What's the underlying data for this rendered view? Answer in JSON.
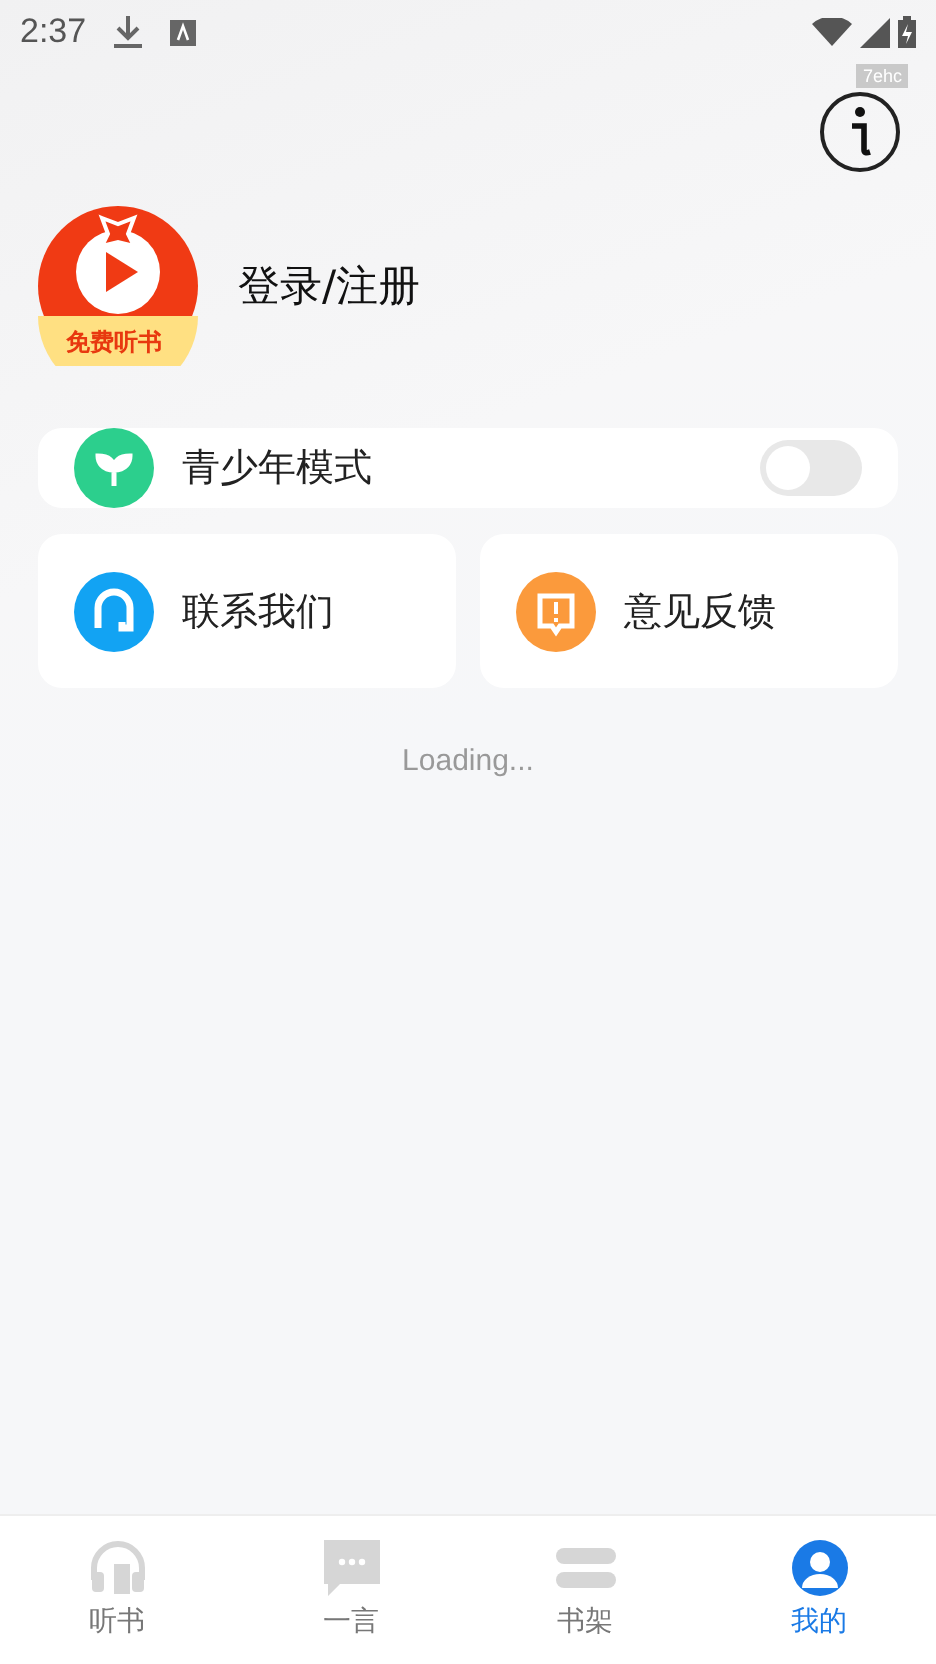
{
  "status_bar": {
    "time": "2:37"
  },
  "debug_tag": "7ehc",
  "profile": {
    "logo_caption": "免费听书",
    "login": "登录/注册"
  },
  "teen_mode": {
    "label": "青少年模式",
    "on": false
  },
  "actions": [
    {
      "kind": "contact",
      "label": "联系我们"
    },
    {
      "kind": "feedback",
      "label": "意见反馈"
    }
  ],
  "loading": "Loading...",
  "tabs": [
    {
      "kind": "listen",
      "label": "听书",
      "selected": false
    },
    {
      "kind": "quote",
      "label": "一言",
      "selected": false
    },
    {
      "kind": "shelf",
      "label": "书架",
      "selected": false
    },
    {
      "kind": "me",
      "label": "我的",
      "selected": true
    }
  ]
}
